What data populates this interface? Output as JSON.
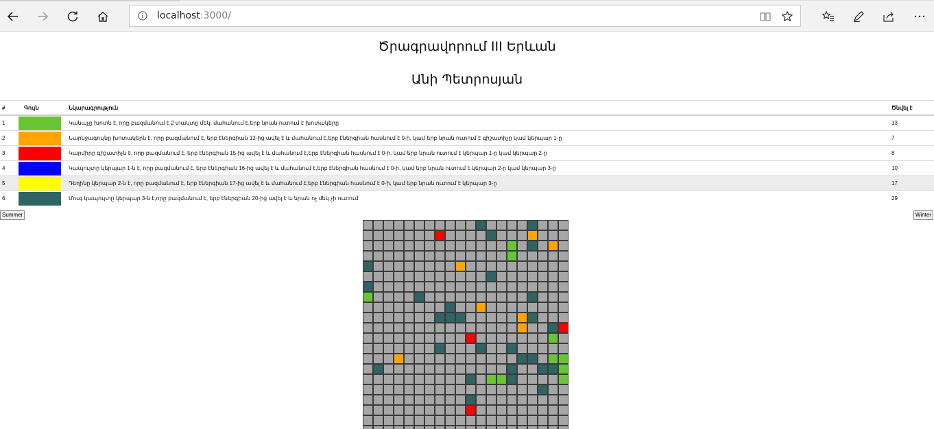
{
  "browser": {
    "url_host": "localhost",
    "url_port": ":3000/"
  },
  "page": {
    "title": "Ծրագրավորում III Երևան",
    "author": "Անի Պետրոսյան"
  },
  "legend": {
    "headers": [
      "#",
      "Գույն",
      "Նկարագրություն",
      "Ծնվել է"
    ],
    "rows": [
      {
        "num": "1",
        "color": "#69c534",
        "desc": "Կանաչը խոտն է, որը բազմանում է 2 տակտը մեկ, մահանում է,երբ նրան ուտում է խոտակերը",
        "born": "13"
      },
      {
        "num": "2",
        "color": "#ffa500",
        "desc": "Նարնջագույնը խոտակերն է, որը բազմանում է, երբ էներգիան 13-ից ավել է և մահանում է,երբ էներգիան հասնում է 0-ի, կամ երբ նրան ուտում է գիշատիչը կամ կերպար 1-ը",
        "born": "7"
      },
      {
        "num": "3",
        "color": "#ff0000",
        "desc": "Կարմիրը գիշատիչն է, որը բազմանում է, երբ էներգիան 15-ից ավել է և մահանում է,երբ էներգիան հասնում է 0-ի, կամ երբ նրան ուտում է կերպար 1-ը կամ կերպար 2-ը",
        "born": "8"
      },
      {
        "num": "4",
        "color": "#0000ff",
        "desc": "Կապույտը կերպար 1-ն է, որը բազմանում է, երբ էներգիան 16-ից ավել է և մահանում է,երբ էներգիան հասնում է 0-ի, կամ երբ նրան ուտում է կերպար 2-ը կամ կերպար 3-ը",
        "born": "10"
      },
      {
        "num": "5",
        "color": "#ffff00",
        "desc": "Դեղինը կերպար 2-ն է, որը բազմանում է, երբ էներգիան 17-ից ավել է և մահանում է,երբ էներգիան հասնում է 0-ի, կամ երբ նրան ուտում է կերպար 3-ը",
        "born": "17"
      },
      {
        "num": "6",
        "color": "#2f6464",
        "desc": "Մուգ կապույտը կերպար 3-ն է,որը բազմանում է, երբ էներգիան 20-ից ավել է և նրան ոչ մեկ չի ուտում",
        "born": "29"
      }
    ]
  },
  "buttons": {
    "summer": "Summer",
    "winter": "Winter"
  },
  "grid": {
    "columns": 20,
    "palette": {
      "0": "#a6a6a6",
      "1": "#69c534",
      "2": "#ffa500",
      "3": "#ff0000",
      "6": "#2f6464"
    },
    "rows": [
      "00000000000600006000",
      "00000003000060002000",
      "00000000000000106020",
      "00000000000000100000",
      "60000000020000000000",
      "00000000000060000000",
      "60000000000000000000",
      "10000600000000006000",
      "00000000600200000000",
      "00000006660000026000",
      "00000000000000020063",
      "00000000003000000010",
      "00000006000600600000",
      "00020000000000066011",
      "06000000000000600661",
      "00000000006011600001",
      "00000000000000000600",
      "00000000006000000000",
      "00000000003000000000",
      "00000000000000000000",
      "00000000000000000000"
    ]
  }
}
